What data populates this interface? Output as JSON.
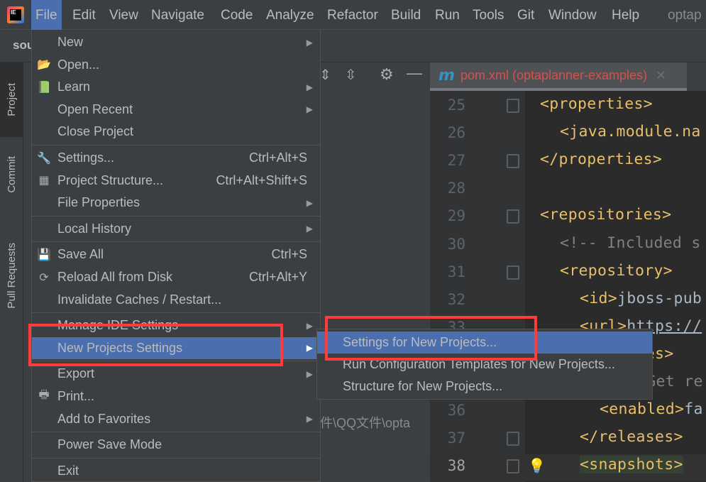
{
  "menubar": {
    "items": [
      "File",
      "Edit",
      "View",
      "Navigate",
      "Code",
      "Analyze",
      "Refactor",
      "Build",
      "Run",
      "Tools",
      "Git",
      "Window",
      "Help"
    ],
    "active": "File",
    "project_title": "optap"
  },
  "toolbar": {
    "breadcrumb": "sou"
  },
  "tool_strip": {
    "tabs": [
      "Project",
      "Commit",
      "Pull Requests"
    ]
  },
  "project_panel": {
    "path_fragment": "文件\\QQ文件\\opta"
  },
  "editor": {
    "tab_label": "pom.xml (optaplanner-examples)",
    "tab_icon": "m",
    "lines": [
      {
        "n": "25",
        "text": "<properties>",
        "indent": 0
      },
      {
        "n": "26",
        "text": "<java.module.na",
        "indent": 1
      },
      {
        "n": "27",
        "text": "</properties>",
        "indent": 0
      },
      {
        "n": "28",
        "text": "",
        "indent": 0
      },
      {
        "n": "29",
        "text": "<repositories>",
        "indent": 0
      },
      {
        "n": "30",
        "text": "<!-- Included s",
        "indent": 1
      },
      {
        "n": "31",
        "text": "<repository>",
        "indent": 1
      },
      {
        "n": "32",
        "text": "<id>jboss-pub",
        "indent": 2
      },
      {
        "n": "33",
        "text": "<url>https://",
        "indent": 2
      },
      {
        "n": "34",
        "text": "<releases>",
        "indent": 2
      },
      {
        "n": "35",
        "text": "<!-- Get re",
        "indent": 3
      },
      {
        "n": "36",
        "text": "<enabled>fa",
        "indent": 3
      },
      {
        "n": "37",
        "text": "</releases>",
        "indent": 2
      },
      {
        "n": "38",
        "text": "<snapshots>",
        "indent": 2
      }
    ]
  },
  "file_menu": [
    {
      "label": "New",
      "arrow": true
    },
    {
      "label": "Open...",
      "icon": "folder-icon"
    },
    {
      "label": "Learn",
      "icon": "book-icon",
      "arrow": true
    },
    {
      "label": "Open Recent",
      "arrow": true
    },
    {
      "label": "Close Project"
    },
    {
      "sep": true
    },
    {
      "label": "Settings...",
      "icon": "wrench-icon",
      "shortcut": "Ctrl+Alt+S"
    },
    {
      "label": "Project Structure...",
      "icon": "project-structure-icon",
      "shortcut": "Ctrl+Alt+Shift+S"
    },
    {
      "label": "File Properties",
      "arrow": true
    },
    {
      "sep": true
    },
    {
      "label": "Local History",
      "arrow": true
    },
    {
      "sep": true
    },
    {
      "label": "Save All",
      "icon": "save-icon",
      "shortcut": "Ctrl+S"
    },
    {
      "label": "Reload All from Disk",
      "icon": "reload-icon",
      "shortcut": "Ctrl+Alt+Y"
    },
    {
      "label": "Invalidate Caches / Restart..."
    },
    {
      "sep": true
    },
    {
      "label": "Manage IDE Settings",
      "arrow": true
    },
    {
      "label": "New Projects Settings",
      "arrow": true,
      "highlighted": true
    },
    {
      "sep": true
    },
    {
      "label": "Export",
      "arrow": true
    },
    {
      "label": "Print...",
      "icon": "print-icon"
    },
    {
      "label": "Add to Favorites",
      "arrow": true
    },
    {
      "sep": true
    },
    {
      "label": "Power Save Mode"
    },
    {
      "sep": true
    },
    {
      "label": "Exit"
    }
  ],
  "submenu": [
    {
      "label": "Settings for New Projects...",
      "highlighted": true
    },
    {
      "label": "Run Configuration Templates for New Projects..."
    },
    {
      "label": "Structure for New Projects..."
    }
  ],
  "colors": {
    "accent": "#4b6eaf",
    "annotation": "#ff3b3b",
    "tag": "#e8bf6a"
  }
}
